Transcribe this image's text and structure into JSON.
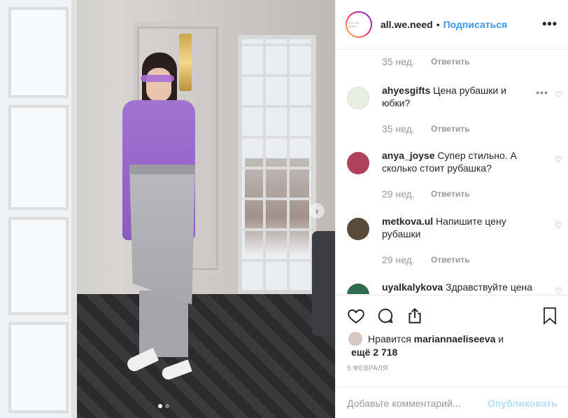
{
  "header": {
    "avatar_text": "ALL WE NEED",
    "username": "all.we.need",
    "separator": "•",
    "follow_label": "Подписаться",
    "more_label": "•••"
  },
  "comments": {
    "first_meta": {
      "week": "35 нед.",
      "reply": "Ответить"
    },
    "items": [
      {
        "user": "ahyesgifts",
        "text": " Цена рубашки и юбки?",
        "week": "35 нед.",
        "reply": "Ответить",
        "avatar_color": "#e8efe0"
      },
      {
        "user": "anya_joyse",
        "text": " Супер стильно. А сколько стоит рубашка?",
        "week": "29 нед.",
        "reply": "Ответить",
        "avatar_color": "#b0425c"
      },
      {
        "user": "metkova.ul",
        "text": " Напишите цену рубашки",
        "week": "29 нед.",
        "reply": "Ответить",
        "avatar_color": "#5a4a3a"
      },
      {
        "user": "uyalkalykova",
        "text": " Здравствуйте цена",
        "week": "",
        "reply": "",
        "avatar_color": "#2f6b4e"
      }
    ],
    "heart_icon": "heart-outline-icon",
    "more_dots": "•••"
  },
  "actions": {
    "icons": [
      "heart-icon",
      "comment-icon",
      "share-icon",
      "bookmark-icon"
    ],
    "likes_prefix": "Нравится ",
    "likes_user": "mariannaeliseeva",
    "likes_mid": " и",
    "likes_more": "ещё 2 718",
    "date": "5 ФЕВРАЛЯ"
  },
  "composer": {
    "placeholder": "Добавьте комментарий...",
    "publish_label": "Опубликовать"
  },
  "carousel": {
    "next_arrow": "›",
    "slides": 2,
    "active_slide": 1
  },
  "colors": {
    "accent": "#3897f0",
    "publish_disabled": "#b2dffc",
    "muted": "#999999"
  }
}
